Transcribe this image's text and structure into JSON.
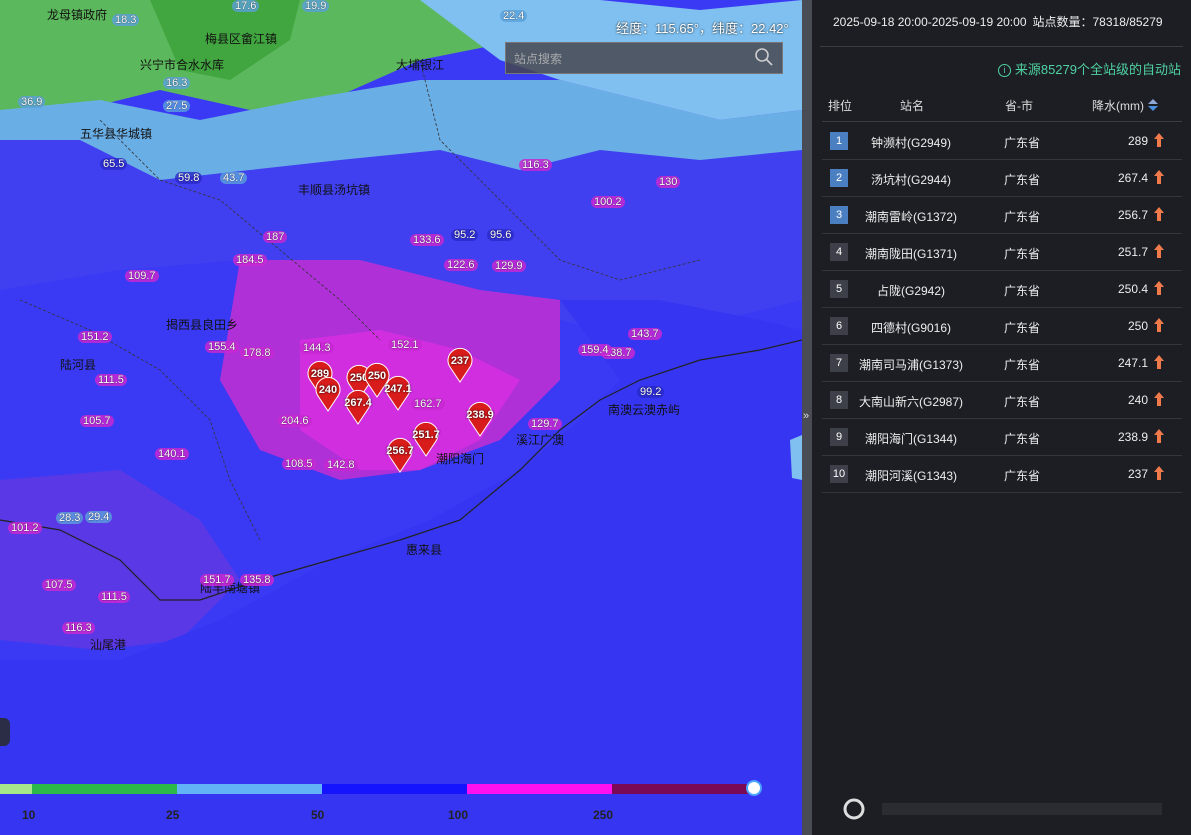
{
  "map": {
    "coordinate_readout": "经度：115.65°，纬度：22.42°",
    "search_placeholder": "站点搜索",
    "place_labels": [
      {
        "text": "龙母镇政府"
      },
      {
        "text": "兴宁市合水水库"
      },
      {
        "text": "梅县区畲江镇"
      },
      {
        "text": "大埔银江"
      },
      {
        "text": "五华县华城镇"
      },
      {
        "text": "丰顺县汤坑镇"
      },
      {
        "text": "揭西县良田乡"
      },
      {
        "text": "陆河县"
      },
      {
        "text": "陆丰南塘镇"
      },
      {
        "text": "南澳云澳赤屿"
      },
      {
        "text": "汕尾港"
      },
      {
        "text": "潮阳海门"
      },
      {
        "text": "溪江广澳"
      },
      {
        "text": "惠来县"
      }
    ],
    "value_labels": [
      "18.3",
      "17.6",
      "19.9",
      "22.4",
      "27.5",
      "16.3",
      "36.9",
      "65.5",
      "59.8",
      "43.7",
      "109.7",
      "151.2",
      "111.5",
      "105.7",
      "140.1",
      "187",
      "184.5",
      "155.4",
      "178.8",
      "204.6",
      "142.8",
      "108.5",
      "116.3",
      "122.6",
      "129.9",
      "95.2",
      "95.6",
      "133.6",
      "130",
      "100.2",
      "143.7",
      "138.7",
      "159.4",
      "129.7",
      "99.2",
      "162.7",
      "152.1",
      "144.3",
      "151.7",
      "135.8",
      "111.5",
      "107.5",
      "116.3",
      "29.4",
      "28.3",
      "101.2"
    ],
    "markers": [
      {
        "value": "289"
      },
      {
        "value": "240"
      },
      {
        "value": "250"
      },
      {
        "value": "250"
      },
      {
        "value": "267.4"
      },
      {
        "value": "247.1"
      },
      {
        "value": "237"
      },
      {
        "value": "238.9"
      },
      {
        "value": "251.7"
      },
      {
        "value": "256.7"
      }
    ],
    "legend": {
      "ticks": [
        "10",
        "25",
        "50",
        "100",
        "250"
      ],
      "colors": [
        "#a6e88a",
        "#2db84a",
        "#62b3f5",
        "#1414ff",
        "#ff10ee",
        "#7a0a55"
      ]
    }
  },
  "panel": {
    "time_range": "2025-09-18 20:00-2025-09-19 20:00",
    "station_count": "站点数量：78318/85279",
    "source_note": "来源85279个全站级的自动站",
    "headers": {
      "rank": "排位",
      "name": "站名",
      "province": "省-市",
      "rain": "降水(mm)"
    },
    "rows": [
      {
        "rank": "1",
        "name": "钟濒村(G2949)",
        "province": "广东省",
        "value": "289"
      },
      {
        "rank": "2",
        "name": "汤坑村(G2944)",
        "province": "广东省",
        "value": "267.4"
      },
      {
        "rank": "3",
        "name": "潮南雷岭(G1372)",
        "province": "广东省",
        "value": "256.7"
      },
      {
        "rank": "4",
        "name": "潮南陇田(G1371)",
        "province": "广东省",
        "value": "251.7"
      },
      {
        "rank": "5",
        "name": "占陇(G2942)",
        "province": "广东省",
        "value": "250.4"
      },
      {
        "rank": "6",
        "name": "四德村(G9016)",
        "province": "广东省",
        "value": "250"
      },
      {
        "rank": "7",
        "name": "潮南司马浦(G1373)",
        "province": "广东省",
        "value": "247.1"
      },
      {
        "rank": "8",
        "name": "大南山新六(G2987)",
        "province": "广东省",
        "value": "240"
      },
      {
        "rank": "9",
        "name": "潮阳海门(G1344)",
        "province": "广东省",
        "value": "238.9"
      },
      {
        "rank": "10",
        "name": "潮阳河溪(G1343)",
        "province": "广东省",
        "value": "237"
      }
    ],
    "colors": {
      "rank_top3": "#4a7fc1",
      "rank_other": "#3d4048",
      "arrow": "#f07a4a",
      "source": "#4fd2a0"
    }
  }
}
